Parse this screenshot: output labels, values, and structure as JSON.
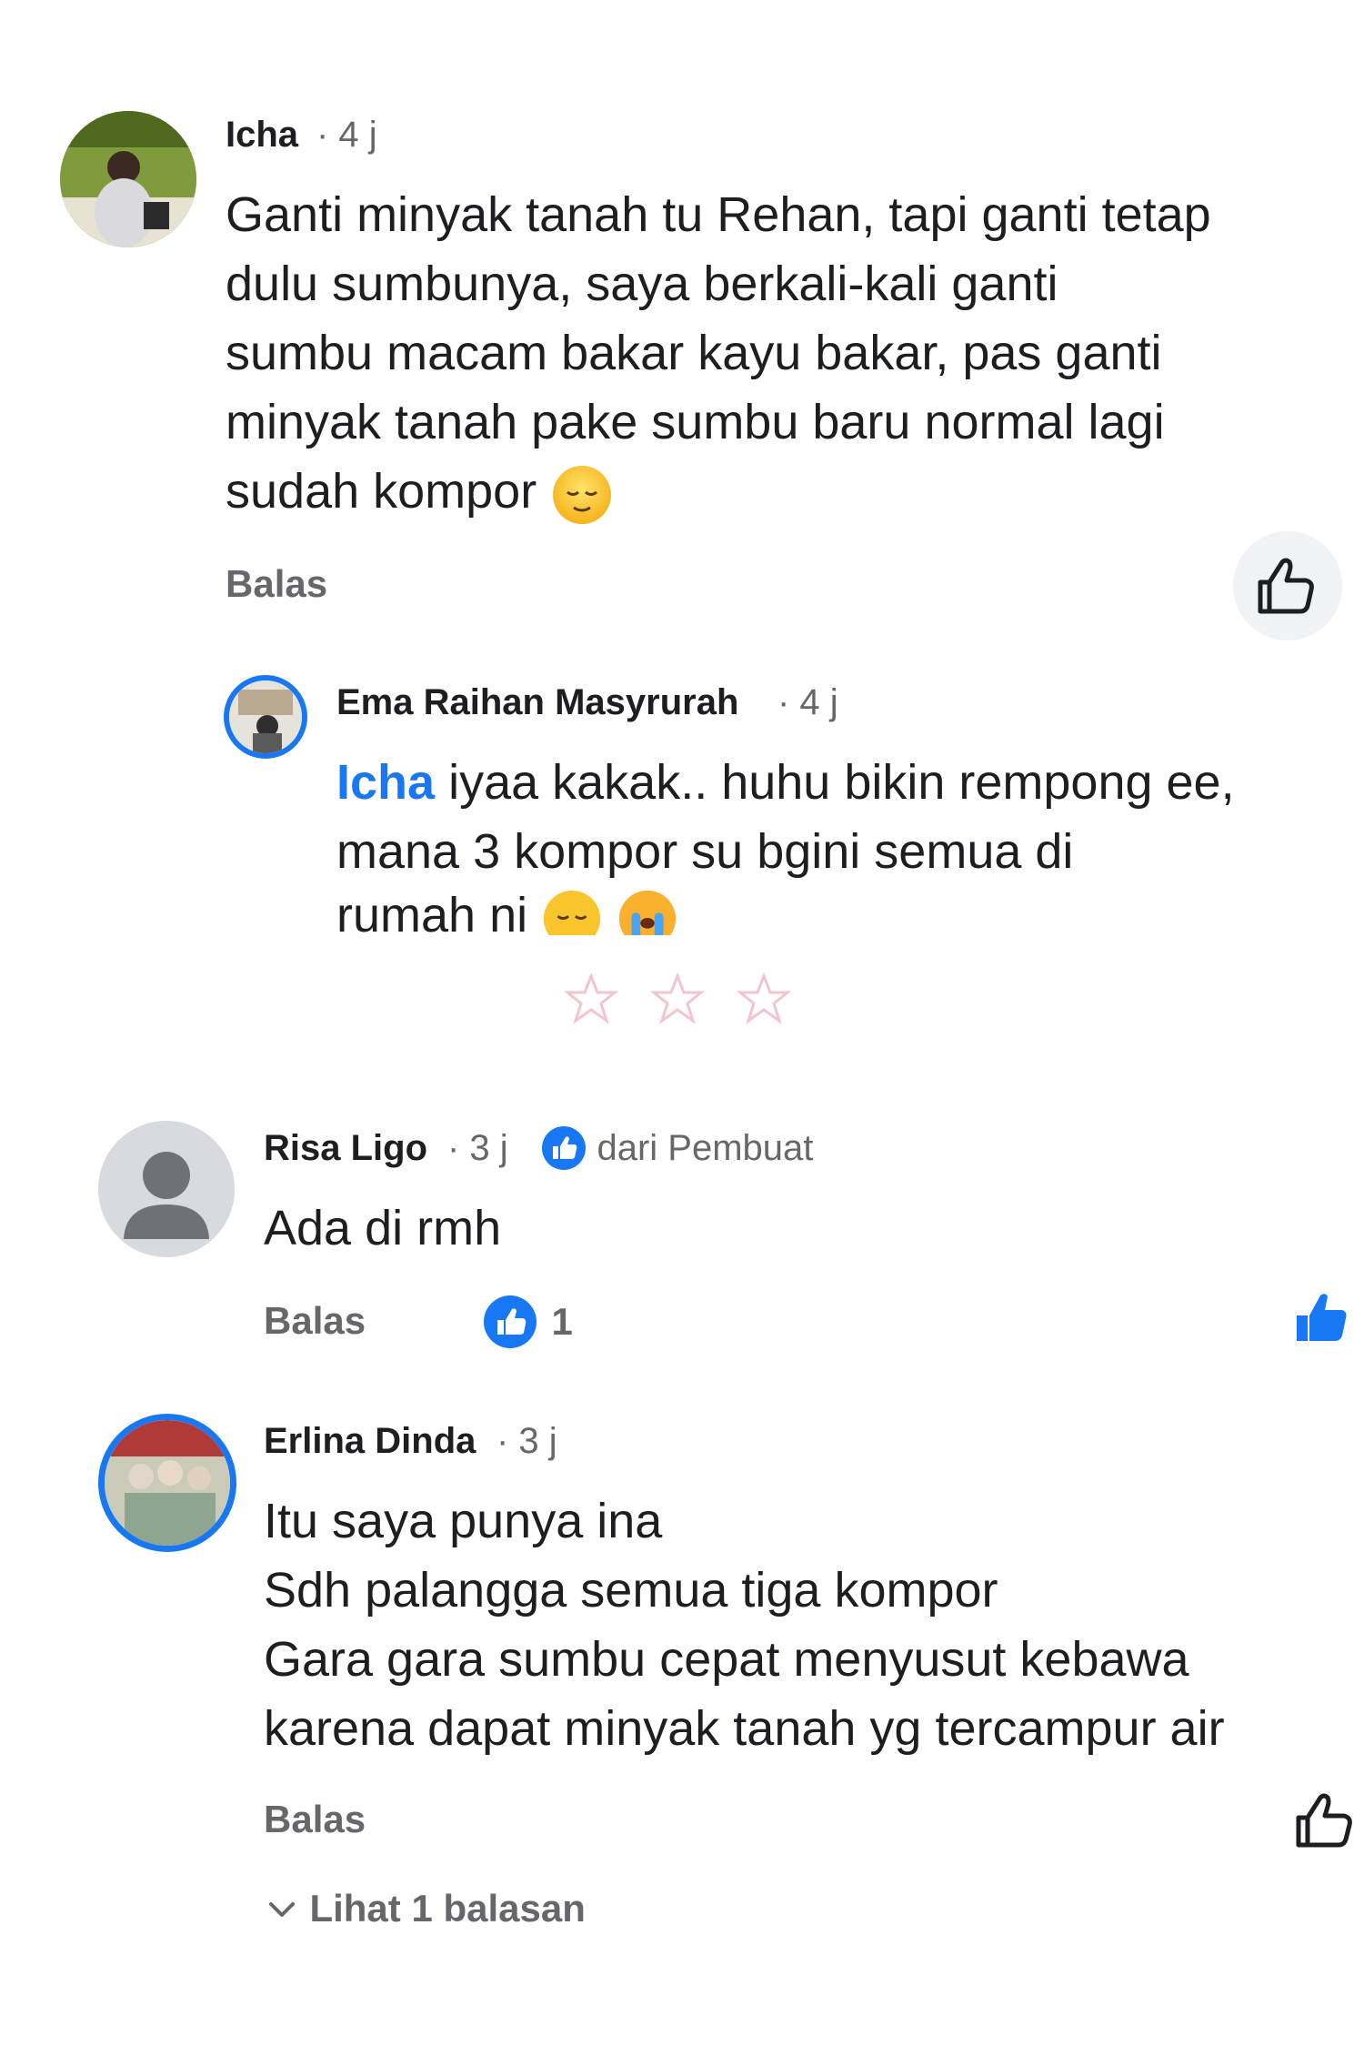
{
  "comments": [
    {
      "name": "Icha",
      "time": "· 4 j",
      "lines": [
        "Ganti minyak tanah tu Rehan, tapi ganti tetap",
        "dulu sumbunya, saya berkali-kali ganti",
        "sumbu macam bakar kayu bakar, pas ganti",
        "minyak tanah pake sumbu baru normal lagi",
        "sudah kompor"
      ],
      "reply_label": "Balas",
      "like_icon": "thumbs-up-outline-icon"
    },
    {
      "name": "Ema Raihan Masyrurah",
      "time": "· 4 j",
      "mention": "Icha",
      "lines": [
        " iyaa kakak.. huhu bikin rempong ee,",
        "mana 3 kompor su bgini semua di",
        "rumah ni"
      ]
    },
    {
      "name": "Risa Ligo",
      "time": "· 3 j",
      "author_badge": "dari Pembuat",
      "lines": [
        "Ada di rmh"
      ],
      "reply_label": "Balas",
      "reaction_count": "1",
      "like_icon": "thumbs-up-filled-icon"
    },
    {
      "name": "Erlina Dinda",
      "time": "· 3 j",
      "lines": [
        "Itu saya punya ina",
        "Sdh palangga semua tiga kompor",
        "Gara gara sumbu cepat menyusut kebawa",
        "karena dapat minyak tanah yg tercampur air"
      ],
      "reply_label": "Balas",
      "like_icon": "thumbs-up-outline-icon",
      "view_replies": "Lihat 1 balasan"
    }
  ],
  "colors": {
    "accent": "#1877f2",
    "secondary_text": "#65676b",
    "primary_text": "#1c1e21",
    "divider_stars": "#f2c4cc"
  }
}
